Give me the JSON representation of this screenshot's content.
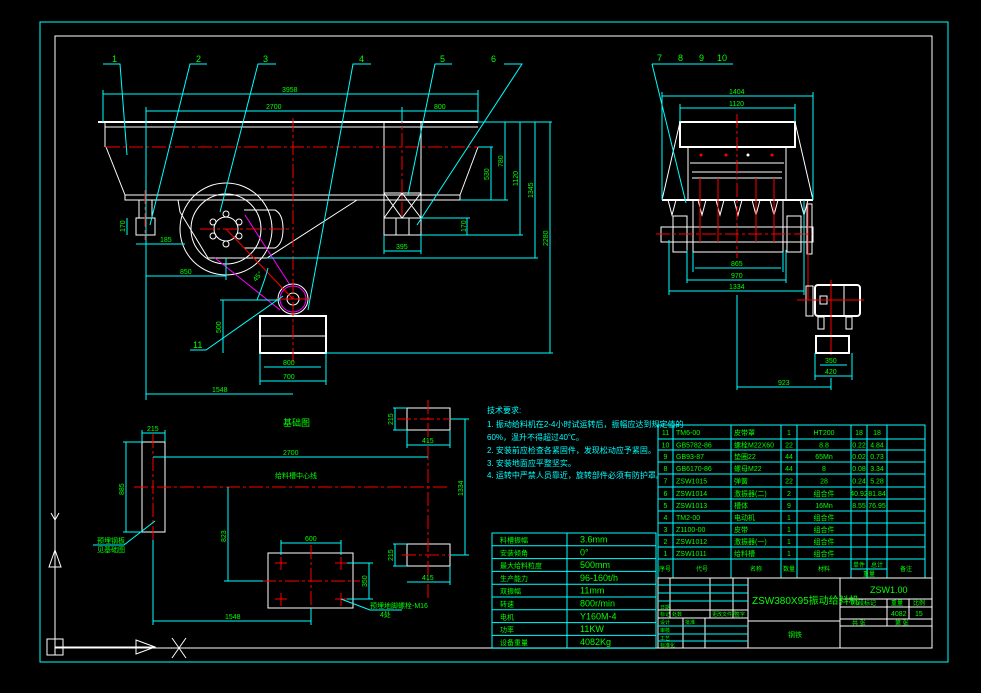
{
  "colors": {
    "background": "#000000",
    "dimension": "#00ffff",
    "text": "#00ff00",
    "outline": "#ffffff",
    "centerline": "#ff0000"
  },
  "front_view": {
    "callouts": [
      "1",
      "2",
      "3",
      "4",
      "5",
      "6",
      "11"
    ],
    "dims": {
      "d3958": "3958",
      "d2700": "2700",
      "d800": "800",
      "d780": "780",
      "d530": "530",
      "d1120": "1120",
      "d1345": "1345",
      "d2280": "2280",
      "d170a": "170",
      "d185": "185",
      "d850": "850",
      "d45": "45°",
      "d500": "500",
      "d800b": "800",
      "d700": "700",
      "d1548": "1548",
      "d395": "395",
      "d170b": "170"
    }
  },
  "side_view": {
    "callouts": [
      "7",
      "8",
      "9",
      "10"
    ],
    "dims": {
      "d1404": "1404",
      "d1120": "1120",
      "d865": "865",
      "d970": "970",
      "d1334": "1334",
      "d350": "350",
      "d420": "420",
      "d923": "923"
    }
  },
  "foundation": {
    "title": "基础图",
    "centerline_label": "给料槽中心线",
    "note_left": [
      "预埋钢板",
      "见基础图"
    ],
    "note_right": [
      "预埋地脚螺栓-M16",
      "4处"
    ],
    "dims": {
      "d215": "215",
      "d885": "885",
      "d2700": "2700",
      "d1334": "1334",
      "d823": "823",
      "d600": "600",
      "d350": "350",
      "d1548": "1548",
      "d215b": "215",
      "d415": "415",
      "d215c": "215",
      "d415b": "415"
    }
  },
  "notes": {
    "title": "技术要求:",
    "lines": [
      "1. 振动给料机在2-4小时试运转后，振幅应达到规定值的",
      "60%，温升不得超过40℃。",
      "2. 安装前应检查各紧固件，发现松动应予紧固。",
      "3. 安装地面应平整坚实。",
      "4. 运转中严禁人员靠近，旋转部件必须有防护罩。"
    ]
  },
  "params": [
    {
      "label": "料槽振幅",
      "value": "3.6mm"
    },
    {
      "label": "安装倾角",
      "value": "0°"
    },
    {
      "label": "最大给料粒度",
      "value": "500mm"
    },
    {
      "label": "生产能力",
      "value": "96-160t/h"
    },
    {
      "label": "双振幅",
      "value": "11mm"
    },
    {
      "label": "转速",
      "value": "800r/min"
    },
    {
      "label": "电机",
      "value": "Y160M-4"
    },
    {
      "label": "功率",
      "value": "11KW"
    },
    {
      "label": "设备重量",
      "value": "4082Kg"
    }
  ],
  "parts": {
    "rows": [
      [
        "11",
        "TM6-00",
        "皮带罩",
        "1",
        "HT200",
        "18",
        "18"
      ],
      [
        "10",
        "GB5782-86",
        "螺栓M22X60",
        "22",
        "8.8",
        "0.22",
        "4.84"
      ],
      [
        "9",
        "GB93-87",
        "垫圈22",
        "44",
        "65Mn",
        "0.02",
        "0.73"
      ],
      [
        "8",
        "GB6170-86",
        "螺母M22",
        "44",
        "8",
        "0.08",
        "3.34"
      ],
      [
        "7",
        "ZSW1015",
        "弹簧",
        "22",
        "28",
        "0.24",
        "5.28"
      ],
      [
        "6",
        "ZSW1014",
        "激振器(二)",
        "2",
        "组合件",
        "40.92",
        "81.84"
      ],
      [
        "5",
        "ZSW1013",
        "槽体",
        "9",
        "16Mn",
        "8.55",
        "76.95"
      ],
      [
        "4",
        "TM2-00",
        "电动机",
        "1",
        "组合件",
        "",
        ""
      ],
      [
        "3",
        "Z1100-00",
        "皮带",
        "1",
        "组合件",
        "",
        ""
      ],
      [
        "2",
        "ZSW1012",
        "激振器(一)",
        "1",
        "组合件",
        "",
        ""
      ],
      [
        "1",
        "ZSW1011",
        "给料槽",
        "1",
        "组合件",
        "",
        ""
      ]
    ],
    "header": {
      "no": "序号",
      "code": "代号",
      "name": "名称",
      "qty": "数量",
      "material": "材料",
      "unit": "单件",
      "total": "总计",
      "weight": "重量",
      "remark": "备注"
    }
  },
  "title_block": {
    "product": "ZSW380X95振动给料机",
    "drawing_no": "ZSW1.00",
    "company": "钢铁",
    "stage_label": "阶段标记",
    "weight_label": "重量",
    "scale_label": "比例",
    "weight": "4082",
    "scale": "15",
    "sheet_a": "共 张",
    "sheet_b": "第 张",
    "left_labels": [
      "标记",
      "处数",
      "更改文件号",
      "签字",
      "日期",
      "设计",
      "审核",
      "工艺",
      "标准化",
      "批准"
    ]
  }
}
